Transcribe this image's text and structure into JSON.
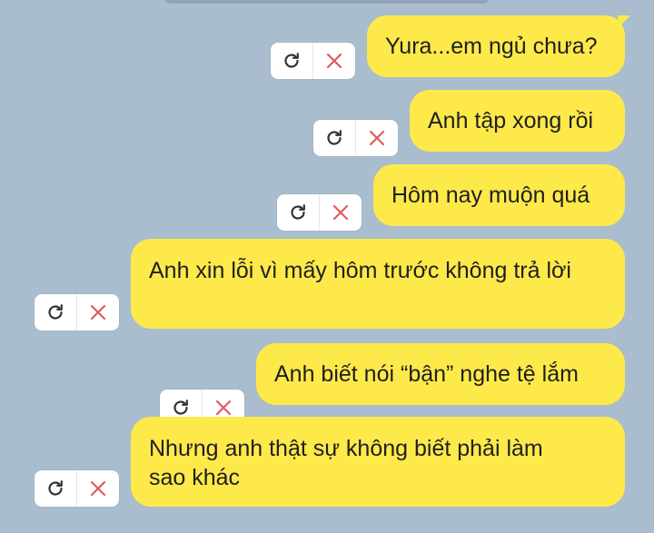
{
  "colors": {
    "background": "#a9bdce",
    "bubble": "#fee94a",
    "retry_icon": "#333333",
    "delete_icon": "#e05a5a"
  },
  "messages": [
    {
      "text": "Yura...em ngủ chưa?"
    },
    {
      "text": "Anh tập xong rồi"
    },
    {
      "text": "Hôm nay muộn quá"
    },
    {
      "text": "Anh xin lỗi vì mấy hôm trước không trả lời"
    },
    {
      "text": "Anh biết nói “bận” nghe tệ lắm"
    },
    {
      "text": "Nhưng anh thật sự không biết phải làm sao khác"
    }
  ],
  "icons": {
    "retry": "retry-icon",
    "delete": "delete-icon"
  }
}
